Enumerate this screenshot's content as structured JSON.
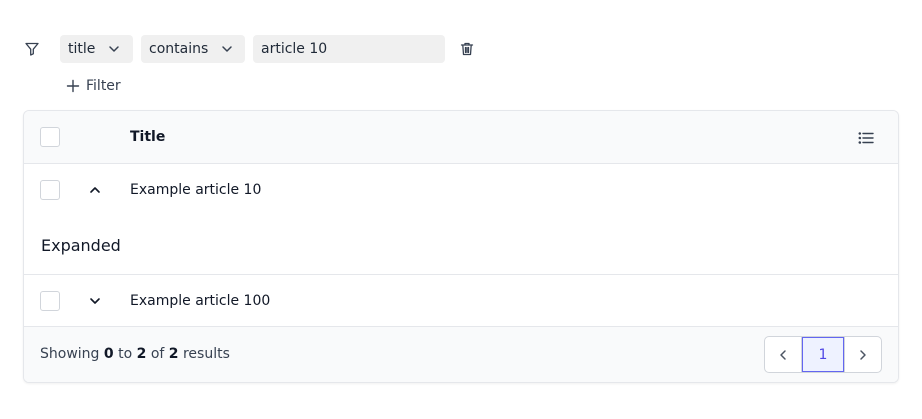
{
  "filter": {
    "field_value": "title",
    "operator_value": "contains",
    "query_value": "article 10",
    "add_filter_label": "Filter"
  },
  "table": {
    "header_title": "Title",
    "rows": [
      {
        "title": "Example article 10",
        "expanded": true,
        "expanded_text": "Expanded"
      },
      {
        "title": "Example article 100",
        "expanded": false
      }
    ]
  },
  "footer": {
    "prefix": "Showing",
    "from": "0",
    "to_word": "to",
    "to": "2",
    "of_word": "of",
    "total": "2",
    "suffix": "results",
    "current_page": "1"
  },
  "colors": {
    "accent": "#4f46e5",
    "input_bg": "#f0f0f0",
    "border": "#e5e7eb"
  },
  "icons": [
    "funnel-icon",
    "chevron-down-icon",
    "trash-icon",
    "plus-icon",
    "list-columns-icon",
    "chevron-up-icon",
    "chevron-left-icon",
    "chevron-right-icon"
  ]
}
